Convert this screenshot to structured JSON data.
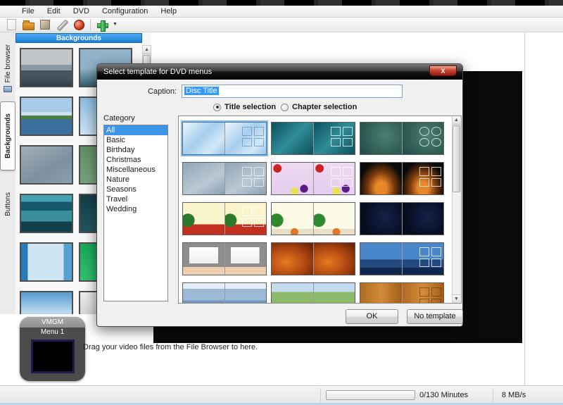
{
  "chrome": {
    "menu_items": [
      "File",
      "Edit",
      "DVD",
      "Configuration",
      "Help"
    ],
    "toolbar_icons": [
      {
        "name": "new-project-icon",
        "style": "ico-new"
      },
      {
        "name": "open-project-icon",
        "style": "ico-open"
      },
      {
        "name": "save-project-icon",
        "style": "ico-save"
      },
      {
        "name": "settings-wrench-icon",
        "style": "ico-wrench"
      },
      {
        "name": "burn-disc-icon",
        "style": "ico-burn"
      },
      {
        "name": "add-file-icon",
        "style": "ico-add",
        "separator_before": true,
        "dropdown": true
      }
    ]
  },
  "sidebar": {
    "tabs": [
      {
        "label": "File browser",
        "active": false
      },
      {
        "label": "Backgrounds",
        "active": true
      },
      {
        "label": "Buttons",
        "active": false
      }
    ]
  },
  "backgrounds_panel": {
    "title": "Backgrounds",
    "thumbnails_left": [
      {
        "name": "ocean-clouds-thumbnail",
        "style": "bg-ocean"
      },
      {
        "name": "lake-shore-thumbnail",
        "style": "bg-lake"
      },
      {
        "name": "gray-blue-gradient-thumbnail",
        "style": "bg-grayblue"
      },
      {
        "name": "teal-stripes-thumbnail",
        "style": "bg-tealstripes"
      },
      {
        "name": "blue-frame-thumbnail",
        "style": "bg-blueframe"
      },
      {
        "name": "blue-gradient-thumbnail",
        "style": "bg-bluegrad"
      }
    ],
    "thumbnails_right": [
      {
        "name": "sea-horizon-thumbnail",
        "style": "bg-sea2"
      },
      {
        "name": "sky-gradient-thumbnail",
        "style": "bg-sky"
      },
      {
        "name": "green-field-thumbnail",
        "style": "bg-green"
      },
      {
        "name": "dark-teal-thumbnail",
        "style": "bg-darkteal"
      },
      {
        "name": "bright-green-thumbnail",
        "style": "bg-greenbright"
      },
      {
        "name": "light-gray-thumbnail",
        "style": "bg-lightgray"
      }
    ]
  },
  "dialog": {
    "title": "Select template for DVD menus",
    "close_glyph": "X",
    "caption_label": "Caption:",
    "caption_value": "Disc Title",
    "radios": [
      {
        "label": "Title selection",
        "selected": true
      },
      {
        "label": "Chapter selection",
        "selected": false
      }
    ],
    "category_label": "Category",
    "categories": [
      "All",
      "Basic",
      "Birthday",
      "Christmas",
      "Miscellaneous",
      "Nature",
      "Seasons",
      "Travel",
      "Wedding"
    ],
    "selected_category": "All",
    "templates": [
      {
        "name": "template-blue-gloss",
        "style": "t-blue1",
        "pattern": "squares",
        "selected": true
      },
      {
        "name": "template-teal-dark",
        "style": "t-teal",
        "pattern": "squares",
        "selected": false
      },
      {
        "name": "template-green-ellipses",
        "style": "t-green",
        "pattern": "circles",
        "selected": false
      },
      {
        "name": "template-slate-grid",
        "style": "t-slate",
        "pattern": "squares",
        "selected": false
      },
      {
        "name": "template-birthday-balloons",
        "style": "t-birthday",
        "pattern": "squares",
        "selected": false
      },
      {
        "name": "template-birthday-candles",
        "style": "t-candles",
        "pattern": "squares",
        "selected": false
      },
      {
        "name": "template-christmas-tree-red",
        "style": "t-xmas1",
        "pattern": "squares",
        "selected": false
      },
      {
        "name": "template-christmas-tree-light",
        "style": "t-xmas2",
        "pattern": "squares",
        "selected": false
      },
      {
        "name": "template-dark-navy",
        "style": "t-navy",
        "pattern": "none",
        "selected": false
      },
      {
        "name": "template-penguin-board",
        "style": "t-penguin",
        "pattern": "none",
        "selected": false
      },
      {
        "name": "template-fire-clouds",
        "style": "t-fire",
        "pattern": "none",
        "selected": false
      },
      {
        "name": "template-city-night",
        "style": "t-city",
        "pattern": "squares",
        "selected": false
      },
      {
        "name": "template-winter-trees",
        "style": "t-winter",
        "pattern": "none",
        "selected": false
      },
      {
        "name": "template-spring-trees",
        "style": "t-spring",
        "pattern": "none",
        "selected": false
      },
      {
        "name": "template-wooden-door",
        "style": "t-wood",
        "pattern": "squares",
        "selected": false
      }
    ],
    "ok_label": "OK",
    "no_template_label": "No template"
  },
  "bottom_panel": {
    "vmgm_label": "VMGM",
    "menu_label": "Menu 1",
    "drag_hint": "Drag your video files from the File Browser to here."
  },
  "status_bar": {
    "minutes": "0/130 Minutes",
    "rate": "8 MB/s"
  },
  "colors": {
    "panel_header_blue": "#2e93e6",
    "selection_blue": "#3399ff",
    "titlebar_dark": "#1b1b1b",
    "close_button_red": "#c94433"
  }
}
